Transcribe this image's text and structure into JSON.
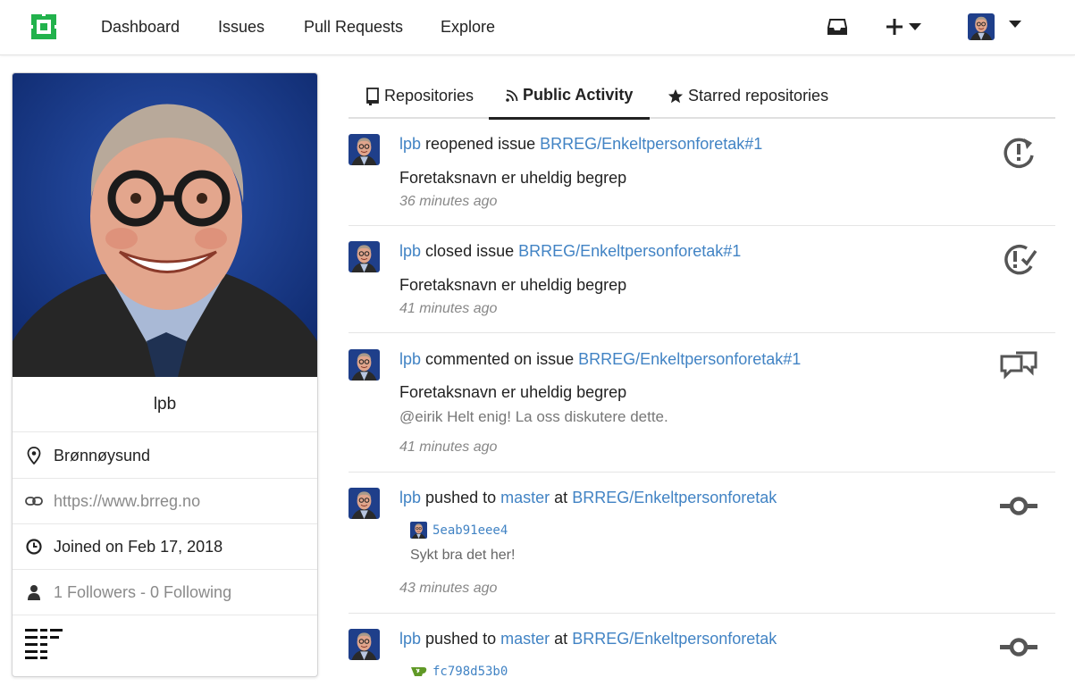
{
  "header": {
    "nav": [
      "Dashboard",
      "Issues",
      "Pull Requests",
      "Explore"
    ],
    "brand_color": "#22b24c"
  },
  "tabs": [
    {
      "label": "Repositories",
      "icon": "book-icon",
      "active": false
    },
    {
      "label": "Public Activity",
      "icon": "rss-icon",
      "active": true
    },
    {
      "label": "Starred repositories",
      "icon": "star-icon",
      "active": false
    }
  ],
  "profile": {
    "username": "lpb",
    "location": "Brønnøysund",
    "website": "https://www.brreg.no",
    "joined": "Joined on Feb 17, 2018",
    "followers": "1 Followers",
    "separator": " - ",
    "following": "0 Following"
  },
  "feed": [
    {
      "user": "lpb",
      "action": "reopened issue",
      "target": "BRREG/Enkeltpersonforetak#1",
      "title": "Foretaksnavn er uheldig begrep",
      "time": "36 minutes ago",
      "icon": "issue-reopened-icon"
    },
    {
      "user": "lpb",
      "action": "closed issue",
      "target": "BRREG/Enkeltpersonforetak#1",
      "title": "Foretaksnavn er uheldig begrep",
      "time": "41 minutes ago",
      "icon": "issue-closed-icon"
    },
    {
      "user": "lpb",
      "action": "commented on issue",
      "target": "BRREG/Enkeltpersonforetak#1",
      "title": "Foretaksnavn er uheldig begrep",
      "comment": "@eirik Helt enig! La oss diskutere dette.",
      "time": "41 minutes ago",
      "icon": "comment-discussion-icon"
    },
    {
      "user": "lpb",
      "action": "pushed to",
      "branch": "master",
      "at": "at",
      "target": "BRREG/Enkeltpersonforetak",
      "commit_sha": "5eab91eee4",
      "commit_msg": "Sykt bra det her!",
      "time": "43 minutes ago",
      "icon": "git-commit-icon"
    },
    {
      "user": "lpb",
      "action": "pushed to",
      "branch": "master",
      "at": "at",
      "target": "BRREG/Enkeltpersonforetak",
      "commit_sha": "fc798d53b0",
      "icon": "git-commit-icon"
    }
  ]
}
